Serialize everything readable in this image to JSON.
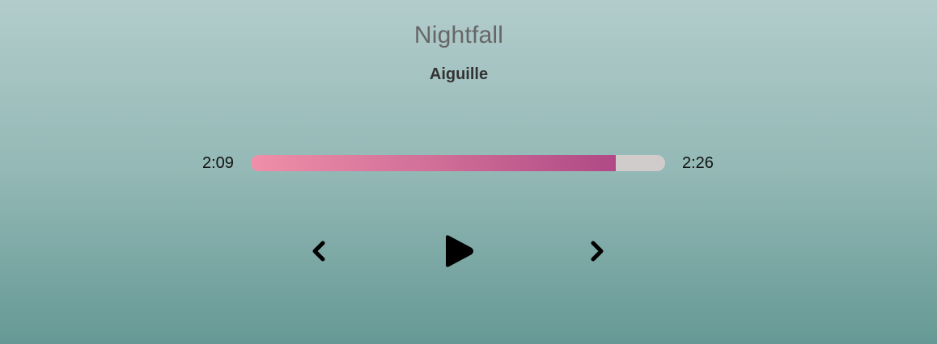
{
  "track": {
    "title": "Nightfall",
    "artist": "Aiguille"
  },
  "player": {
    "current_time": "2:09",
    "total_time": "2:26",
    "progress_fraction": 0.88
  },
  "controls": {
    "prev_icon": "chevron-left-icon",
    "play_icon": "play-icon",
    "next_icon": "chevron-right-icon"
  },
  "colors": {
    "progress_start": "#ef8fa8",
    "progress_end": "#b04985",
    "track_background": "#d0cccc",
    "background_top": "#b2cccc",
    "background_bottom": "#669995"
  }
}
